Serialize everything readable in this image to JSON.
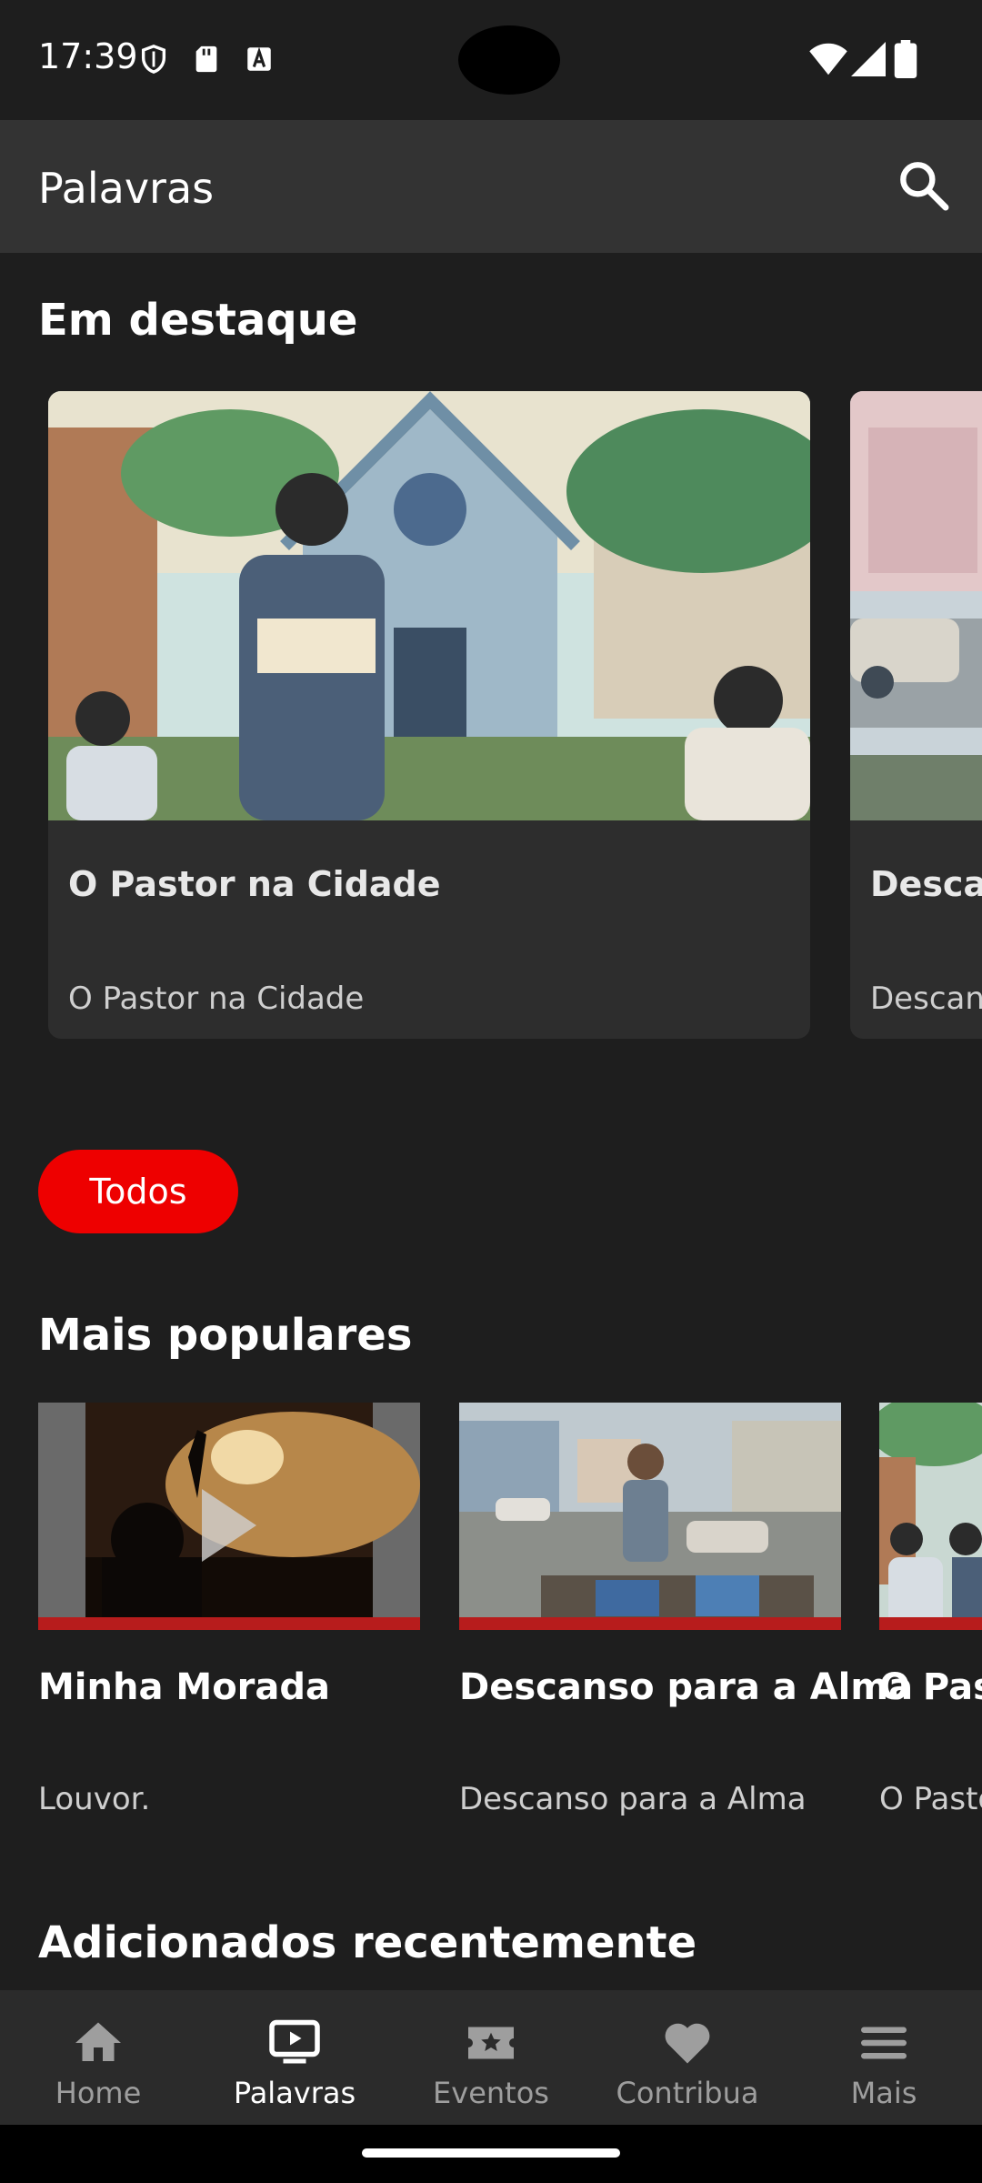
{
  "status_bar": {
    "time": "17:39"
  },
  "app_bar": {
    "title": "Palavras",
    "search_icon": "search-icon"
  },
  "featured": {
    "title": "Em destaque",
    "cards": [
      {
        "title": "O Pastor na Cidade",
        "subtitle": "O Pastor na Cidade"
      },
      {
        "title": "Descar",
        "subtitle": "Descan"
      }
    ]
  },
  "filter": {
    "chip_label": "Todos",
    "chip_color": "#ee0000"
  },
  "popular": {
    "title": "Mais populares",
    "items": [
      {
        "title": "Minha Morada",
        "subtitle": "Louvor.",
        "progress": 1.0
      },
      {
        "title": "Descanso para a Alma",
        "subtitle": "Descanso para a Alma",
        "progress": 1.0
      },
      {
        "title": "O Past",
        "subtitle": "O Pasto",
        "progress": 1.0
      }
    ]
  },
  "recent": {
    "title": "Adicionados recentemente"
  },
  "bottom_nav": {
    "items": [
      {
        "label": "Home",
        "icon": "home-icon",
        "active": false
      },
      {
        "label": "Palavras",
        "icon": "tv-play-icon",
        "active": true
      },
      {
        "label": "Eventos",
        "icon": "ticket-star-icon",
        "active": false
      },
      {
        "label": "Contribua",
        "icon": "heart-icon",
        "active": false
      },
      {
        "label": "Mais",
        "icon": "menu-icon",
        "active": false
      }
    ]
  },
  "colors": {
    "accent": "#ee0000",
    "progress": "#b71c1c",
    "background": "#1e1e1e",
    "appbar": "#333333"
  }
}
